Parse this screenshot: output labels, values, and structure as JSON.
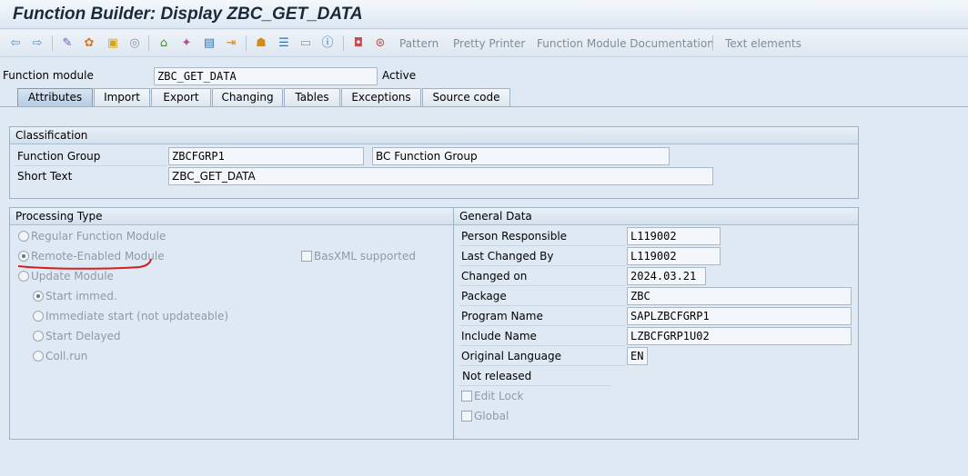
{
  "window": {
    "title": "Function Builder: Display ZBC_GET_DATA"
  },
  "toolbar": {
    "icons": [
      "back-arrow-icon",
      "forward-arrow-icon",
      "display-change-icon",
      "other-object-icon",
      "activate-icon",
      "check-icon",
      "where-used-icon",
      "hierarchy-icon",
      "wand-icon",
      "display-object-list-icon",
      "navigation-icon",
      "tree-icon",
      "stack-icon",
      "frame-icon",
      "info-icon",
      "breakpoint-icon",
      "test-icon"
    ],
    "pattern": "Pattern",
    "pretty_printer": "Pretty Printer",
    "fm_documentation": "Function Module Documentation",
    "text_elements": "Text elements"
  },
  "header": {
    "function_module_label": "Function module",
    "function_module_value": "ZBC_GET_DATA",
    "status": "Active"
  },
  "tabs": [
    {
      "label": "Attributes",
      "active": true
    },
    {
      "label": "Import"
    },
    {
      "label": "Export"
    },
    {
      "label": "Changing"
    },
    {
      "label": "Tables"
    },
    {
      "label": "Exceptions"
    },
    {
      "label": "Source code"
    }
  ],
  "classification": {
    "title": "Classification",
    "function_group_label": "Function Group",
    "function_group_value": "ZBCFGRP1",
    "function_group_desc": "BC Function Group",
    "short_text_label": "Short Text",
    "short_text_value": "ZBC_GET_DATA"
  },
  "processing_type": {
    "title": "Processing Type",
    "regular": "Regular Function Module",
    "remote": "Remote-Enabled Module",
    "basxml": "BasXML supported",
    "update": "Update Module",
    "start_immed": "Start immed.",
    "immediate_start": "Immediate start (not updateable)",
    "start_delayed": "Start Delayed",
    "coll_run": "Coll.run",
    "annotation_color": "#d42020"
  },
  "general_data": {
    "title": "General Data",
    "person_responsible_label": "Person Responsible",
    "person_responsible_value": "L119002",
    "last_changed_by_label": "Last Changed By",
    "last_changed_by_value": "L119002",
    "changed_on_label": "Changed on",
    "changed_on_value": "2024.03.21",
    "package_label": "Package",
    "package_value": "ZBC",
    "program_name_label": "Program Name",
    "program_name_value": "SAPLZBCFGRP1",
    "include_name_label": "Include Name",
    "include_name_value": "LZBCFGRP1U02",
    "original_language_label": "Original Language",
    "original_language_value": "EN",
    "release_status": "Not released",
    "edit_lock": "Edit Lock",
    "global": "Global"
  }
}
